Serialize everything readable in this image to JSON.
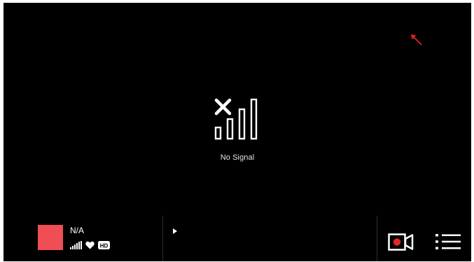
{
  "signal": {
    "message": "No Signal",
    "icon": "no-signal-icon"
  },
  "channel": {
    "name": "N/A",
    "thumbnail_color": "#ef4e55",
    "badges": [
      "signal-bars-icon",
      "heart-icon",
      "hd-badge-icon"
    ],
    "hd_label": "HD"
  },
  "controls": {
    "play_icon": "play-icon",
    "record_icon": "record-video-icon",
    "menu_icon": "menu-list-icon",
    "arrow_color": "#e02020"
  }
}
